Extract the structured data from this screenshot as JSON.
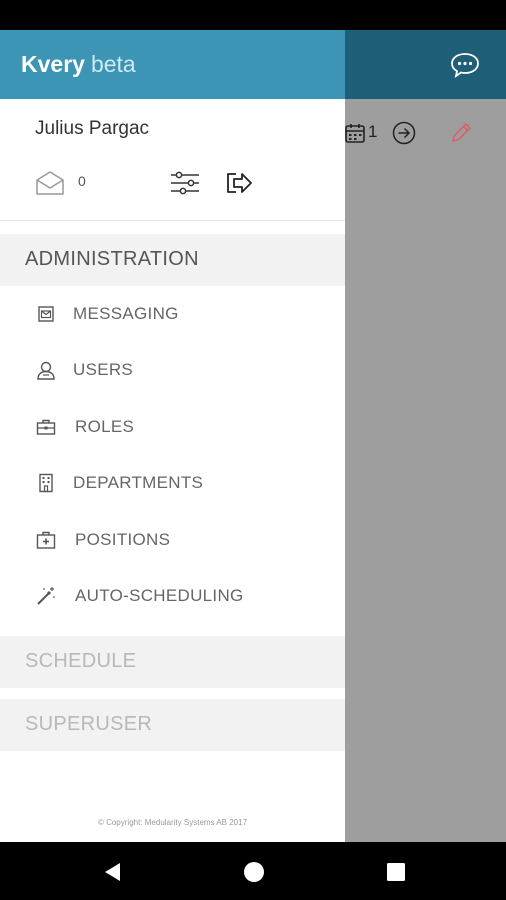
{
  "brand": {
    "name": "Kvery",
    "tag": "beta"
  },
  "user": {
    "name": "Julius Pargac",
    "message_count": "0"
  },
  "background": {
    "calendar_count": "1"
  },
  "sections": {
    "administration": "ADMINISTRATION",
    "schedule": "SCHEDULE",
    "superuser": "SUPERUSER"
  },
  "admin_items": [
    {
      "label": "MESSAGING",
      "icon": "messaging-icon"
    },
    {
      "label": "USERS",
      "icon": "users-icon"
    },
    {
      "label": "ROLES",
      "icon": "roles-icon"
    },
    {
      "label": "DEPARTMENTS",
      "icon": "departments-icon"
    },
    {
      "label": "POSITIONS",
      "icon": "positions-icon"
    },
    {
      "label": "AUTO-SCHEDULING",
      "icon": "magic-wand-icon"
    }
  ],
  "footer": {
    "copyright": "© Copyright: Medularity Systems AB 2017"
  },
  "colors": {
    "header_drawer": "#3d95b6",
    "header_app": "#1e5f77",
    "edit_accent": "#d9606e"
  }
}
